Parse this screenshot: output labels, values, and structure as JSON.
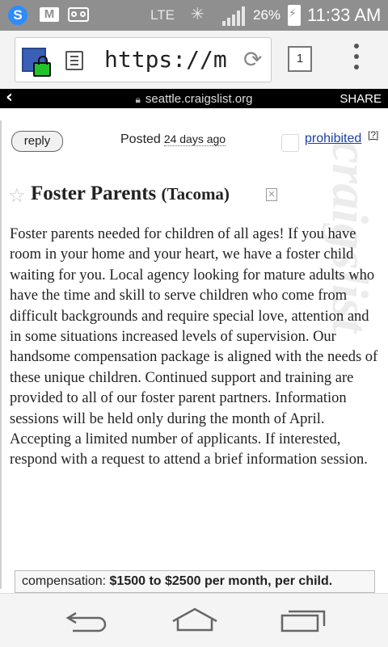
{
  "status_bar": {
    "network": "LTE",
    "battery": "26%",
    "time": "11:33 AM",
    "app_icon_letter": "S",
    "mail_icon_letter": "M"
  },
  "browser": {
    "url": "https://m",
    "tab_count": "1"
  },
  "site_header": {
    "domain": "seattle.craigslist.org",
    "share": "SHARE"
  },
  "listing": {
    "reply_label": "reply",
    "posted_label": "Posted",
    "posted_ago": "24 days ago",
    "prohibited_label": "prohibited",
    "help_label": "[?]",
    "title": "Foster Parents",
    "location": "(Tacoma)",
    "body": "Foster parents needed for children of all ages! If you have room in your home and your heart, we have a foster child waiting for you. Local agency looking for mature adults who have the time and skill to serve children who come from difficult backgrounds and require special love, attention and in some situations increased levels of supervision. Our handsome compensation package is aligned with the needs of these unique children. Continued support and training are provided to all of our foster parent partners. Information sessions will be held only during the month of April. Accepting a limited number of applicants. If interested, respond with a request to attend a brief information session.",
    "compensation_label": "compensation:",
    "compensation_value": "$1500 to $2500 per month, per child.",
    "watermark": "craigslist"
  }
}
